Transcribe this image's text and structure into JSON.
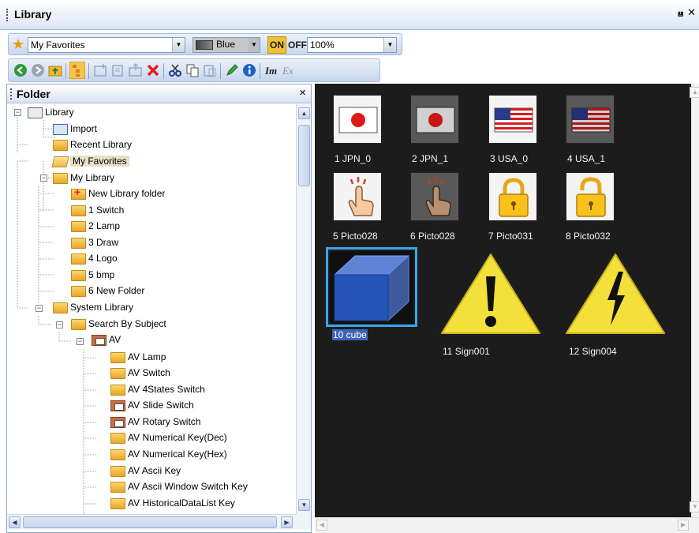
{
  "window": {
    "title": "Library",
    "pin_glyph": "⩏",
    "close_glyph": "✕"
  },
  "toolbar1": {
    "favorites_value": "My Favorites",
    "color_value": "Blue",
    "on_label": "ON",
    "off_label": "OFF",
    "zoom_value": "100%"
  },
  "folder_pane": {
    "title": "Folder",
    "tree": [
      {
        "label": "Library",
        "icon": "library-icon"
      },
      {
        "label": "Import",
        "icon": "import-icon"
      },
      {
        "label": "Recent Library",
        "icon": "folder-icon"
      },
      {
        "label": "My Favorites",
        "icon": "folder-open-icon",
        "selected": true
      },
      {
        "label": "My Library",
        "icon": "folder-icon"
      },
      {
        "label": "New Library folder",
        "icon": "new-folder-icon"
      },
      {
        "label": "1 Switch",
        "icon": "folder-icon"
      },
      {
        "label": "2 Lamp",
        "icon": "folder-icon"
      },
      {
        "label": "3 Draw",
        "icon": "folder-icon"
      },
      {
        "label": "4 Logo",
        "icon": "folder-icon"
      },
      {
        "label": "5 bmp",
        "icon": "folder-icon"
      },
      {
        "label": "6 New Folder",
        "icon": "folder-icon"
      },
      {
        "label": "System Library",
        "icon": "folder-icon"
      },
      {
        "label": "Search By Subject",
        "icon": "folder-icon"
      },
      {
        "label": "AV",
        "icon": "av-folder-icon"
      },
      {
        "label": "AV Lamp",
        "icon": "folder-icon"
      },
      {
        "label": "AV Switch",
        "icon": "folder-icon"
      },
      {
        "label": "AV 4States Switch",
        "icon": "folder-icon"
      },
      {
        "label": "AV Slide Switch",
        "icon": "av-document-icon"
      },
      {
        "label": "AV Rotary Switch",
        "icon": "av-document-icon"
      },
      {
        "label": "AV Numerical Key(Dec)",
        "icon": "folder-icon"
      },
      {
        "label": "AV Numerical Key(Hex)",
        "icon": "folder-icon"
      },
      {
        "label": "AV Ascii Key",
        "icon": "folder-icon"
      },
      {
        "label": "AV Ascii Window Switch Key",
        "icon": "folder-icon"
      },
      {
        "label": "AV HistoricalDataList Key",
        "icon": "folder-icon"
      }
    ]
  },
  "gallery": {
    "items": [
      {
        "label": "1 JPN_0",
        "icon": "japan-flag-icon"
      },
      {
        "label": "2 JPN_1",
        "icon": "japan-flag-dark-icon"
      },
      {
        "label": "3 USA_0",
        "icon": "usa-flag-icon"
      },
      {
        "label": "4 USA_1",
        "icon": "usa-flag-dark-icon"
      },
      {
        "label": "5 Picto028",
        "icon": "touch-hand-icon"
      },
      {
        "label": "6 Picto028",
        "icon": "touch-hand-dark-icon"
      },
      {
        "label": "7 Picto031",
        "icon": "lock-closed-icon"
      },
      {
        "label": "8 Picto032",
        "icon": "lock-open-icon"
      },
      {
        "label": "10 cube",
        "icon": "cube-icon",
        "selected": true
      },
      {
        "label": "11 Sign001",
        "icon": "warning-exclamation-icon"
      },
      {
        "label": "12 Sign004",
        "icon": "high-voltage-icon"
      }
    ]
  },
  "colors": {
    "gallery_bg": "#1c1c1c",
    "selection": "#3aa4ea",
    "toolbar": "#c6d6ee",
    "on_button": "#f2c13a"
  }
}
